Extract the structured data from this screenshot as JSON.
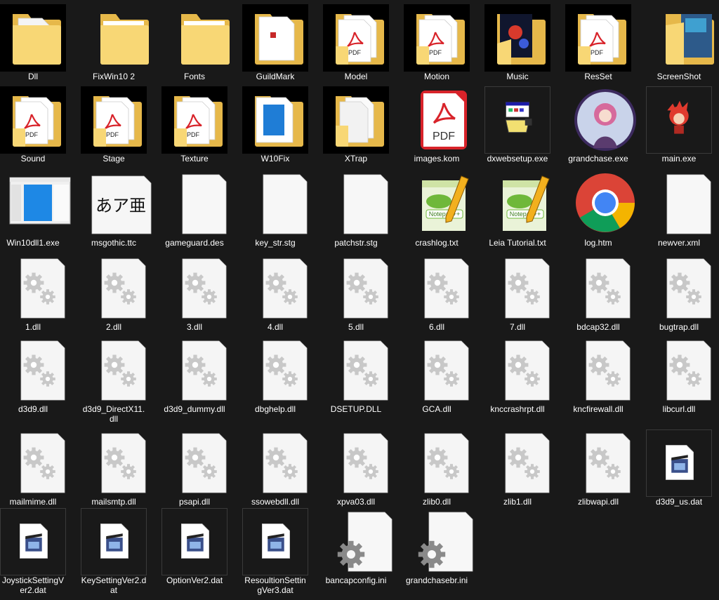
{
  "items": [
    {
      "name": "Dll",
      "icon": "folder-dll",
      "style": "black"
    },
    {
      "name": "FixWin10 2",
      "icon": "folder",
      "style": ""
    },
    {
      "name": "Fonts",
      "icon": "folder",
      "style": ""
    },
    {
      "name": "GuildMark",
      "icon": "folder-white",
      "style": "black"
    },
    {
      "name": "Model",
      "icon": "folder-pdf",
      "style": "black"
    },
    {
      "name": "Motion",
      "icon": "folder-pdf",
      "style": "black"
    },
    {
      "name": "Music",
      "icon": "folder-image",
      "style": "black"
    },
    {
      "name": "ResSet",
      "icon": "folder-pdf",
      "style": "black"
    },
    {
      "name": "ScreenShot",
      "icon": "folder-screenshot",
      "style": ""
    },
    {
      "name": "Sound",
      "icon": "folder-pdf",
      "style": "black"
    },
    {
      "name": "Stage",
      "icon": "folder-pdf",
      "style": "black"
    },
    {
      "name": "Texture",
      "icon": "folder-pdf",
      "style": "black"
    },
    {
      "name": "W10Fix",
      "icon": "folder-blue",
      "style": "black"
    },
    {
      "name": "XTrap",
      "icon": "folder-docs",
      "style": "black"
    },
    {
      "name": "images.kom",
      "icon": "pdf-file",
      "style": ""
    },
    {
      "name": "dxwebsetup.exe",
      "icon": "setup-exe",
      "style": "boxed"
    },
    {
      "name": "grandchase.exe",
      "icon": "game-avatar",
      "style": ""
    },
    {
      "name": "main.exe",
      "icon": "game-char",
      "style": "boxed"
    },
    {
      "name": "Win10dll1.exe",
      "icon": "window-exe",
      "style": ""
    },
    {
      "name": "msgothic.ttc",
      "icon": "font-file",
      "style": ""
    },
    {
      "name": "gameguard.des",
      "icon": "blank-file",
      "style": ""
    },
    {
      "name": "key_str.stg",
      "icon": "blank-file",
      "style": ""
    },
    {
      "name": "patchstr.stg",
      "icon": "blank-file",
      "style": ""
    },
    {
      "name": "crashlog.txt",
      "icon": "notepad-file",
      "style": ""
    },
    {
      "name": "Leia Tutorial.txt",
      "icon": "notepad-file",
      "style": ""
    },
    {
      "name": "log.htm",
      "icon": "chrome-file",
      "style": ""
    },
    {
      "name": "newver.xml",
      "icon": "blank-file",
      "style": ""
    },
    {
      "name": "1.dll",
      "icon": "dll-file",
      "style": ""
    },
    {
      "name": "2.dll",
      "icon": "dll-file",
      "style": ""
    },
    {
      "name": "3.dll",
      "icon": "dll-file",
      "style": ""
    },
    {
      "name": "4.dll",
      "icon": "dll-file",
      "style": ""
    },
    {
      "name": "5.dll",
      "icon": "dll-file",
      "style": ""
    },
    {
      "name": "6.dll",
      "icon": "dll-file",
      "style": ""
    },
    {
      "name": "7.dll",
      "icon": "dll-file",
      "style": ""
    },
    {
      "name": "bdcap32.dll",
      "icon": "dll-file",
      "style": ""
    },
    {
      "name": "bugtrap.dll",
      "icon": "dll-file",
      "style": ""
    },
    {
      "name": "d3d9.dll",
      "icon": "dll-file",
      "style": ""
    },
    {
      "name": "d3d9_DirectX11.dll",
      "icon": "dll-file",
      "style": ""
    },
    {
      "name": "d3d9_dummy.dll",
      "icon": "dll-file",
      "style": ""
    },
    {
      "name": "dbghelp.dll",
      "icon": "dll-file",
      "style": ""
    },
    {
      "name": "DSETUP.DLL",
      "icon": "dll-file",
      "style": ""
    },
    {
      "name": "GCA.dll",
      "icon": "dll-file",
      "style": ""
    },
    {
      "name": "knccrashrpt.dll",
      "icon": "dll-file",
      "style": ""
    },
    {
      "name": "kncfirewall.dll",
      "icon": "dll-file",
      "style": ""
    },
    {
      "name": "libcurl.dll",
      "icon": "dll-file",
      "style": ""
    },
    {
      "name": "mailmime.dll",
      "icon": "dll-file",
      "style": ""
    },
    {
      "name": "mailsmtp.dll",
      "icon": "dll-file",
      "style": ""
    },
    {
      "name": "psapi.dll",
      "icon": "dll-file",
      "style": ""
    },
    {
      "name": "ssowebdll.dll",
      "icon": "dll-file",
      "style": ""
    },
    {
      "name": "xpva03.dll",
      "icon": "dll-file",
      "style": ""
    },
    {
      "name": "zlib0.dll",
      "icon": "dll-file",
      "style": ""
    },
    {
      "name": "zlib1.dll",
      "icon": "dll-file",
      "style": ""
    },
    {
      "name": "zlibwapi.dll",
      "icon": "dll-file",
      "style": ""
    },
    {
      "name": "d3d9_us.dat",
      "icon": "media-file",
      "style": "boxed"
    },
    {
      "name": "JoystickSettingVer2.dat",
      "icon": "media-file",
      "style": "boxed"
    },
    {
      "name": "KeySettingVer2.dat",
      "icon": "media-file",
      "style": "boxed"
    },
    {
      "name": "OptionVer2.dat",
      "icon": "media-file",
      "style": "boxed"
    },
    {
      "name": "ResoultionSettingVer3.dat",
      "icon": "media-file",
      "style": "boxed"
    },
    {
      "name": "bancapconfig.ini",
      "icon": "ini-file",
      "style": ""
    },
    {
      "name": "grandchasebr.ini",
      "icon": "ini-file",
      "style": ""
    }
  ]
}
